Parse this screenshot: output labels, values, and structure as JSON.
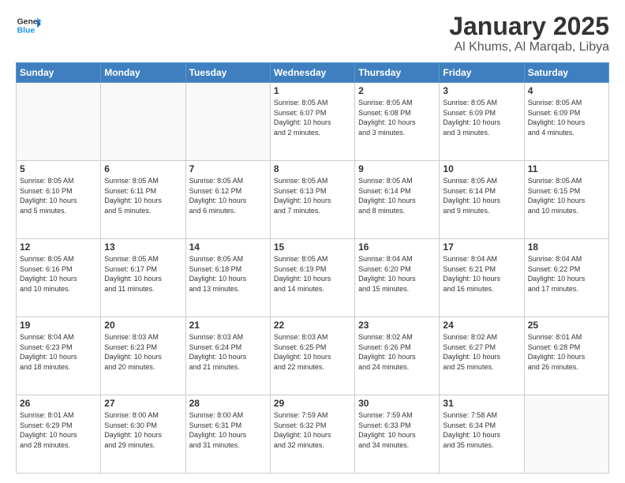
{
  "header": {
    "logo_line1": "General",
    "logo_line2": "Blue",
    "month": "January 2025",
    "location": "Al Khums, Al Marqab, Libya"
  },
  "days_of_week": [
    "Sunday",
    "Monday",
    "Tuesday",
    "Wednesday",
    "Thursday",
    "Friday",
    "Saturday"
  ],
  "weeks": [
    [
      {
        "day": "",
        "info": ""
      },
      {
        "day": "",
        "info": ""
      },
      {
        "day": "",
        "info": ""
      },
      {
        "day": "1",
        "info": "Sunrise: 8:05 AM\nSunset: 6:07 PM\nDaylight: 10 hours\nand 2 minutes."
      },
      {
        "day": "2",
        "info": "Sunrise: 8:05 AM\nSunset: 6:08 PM\nDaylight: 10 hours\nand 3 minutes."
      },
      {
        "day": "3",
        "info": "Sunrise: 8:05 AM\nSunset: 6:09 PM\nDaylight: 10 hours\nand 3 minutes."
      },
      {
        "day": "4",
        "info": "Sunrise: 8:05 AM\nSunset: 6:09 PM\nDaylight: 10 hours\nand 4 minutes."
      }
    ],
    [
      {
        "day": "5",
        "info": "Sunrise: 8:05 AM\nSunset: 6:10 PM\nDaylight: 10 hours\nand 5 minutes."
      },
      {
        "day": "6",
        "info": "Sunrise: 8:05 AM\nSunset: 6:11 PM\nDaylight: 10 hours\nand 5 minutes."
      },
      {
        "day": "7",
        "info": "Sunrise: 8:05 AM\nSunset: 6:12 PM\nDaylight: 10 hours\nand 6 minutes."
      },
      {
        "day": "8",
        "info": "Sunrise: 8:05 AM\nSunset: 6:13 PM\nDaylight: 10 hours\nand 7 minutes."
      },
      {
        "day": "9",
        "info": "Sunrise: 8:05 AM\nSunset: 6:14 PM\nDaylight: 10 hours\nand 8 minutes."
      },
      {
        "day": "10",
        "info": "Sunrise: 8:05 AM\nSunset: 6:14 PM\nDaylight: 10 hours\nand 9 minutes."
      },
      {
        "day": "11",
        "info": "Sunrise: 8:05 AM\nSunset: 6:15 PM\nDaylight: 10 hours\nand 10 minutes."
      }
    ],
    [
      {
        "day": "12",
        "info": "Sunrise: 8:05 AM\nSunset: 6:16 PM\nDaylight: 10 hours\nand 10 minutes."
      },
      {
        "day": "13",
        "info": "Sunrise: 8:05 AM\nSunset: 6:17 PM\nDaylight: 10 hours\nand 11 minutes."
      },
      {
        "day": "14",
        "info": "Sunrise: 8:05 AM\nSunset: 6:18 PM\nDaylight: 10 hours\nand 13 minutes."
      },
      {
        "day": "15",
        "info": "Sunrise: 8:05 AM\nSunset: 6:19 PM\nDaylight: 10 hours\nand 14 minutes."
      },
      {
        "day": "16",
        "info": "Sunrise: 8:04 AM\nSunset: 6:20 PM\nDaylight: 10 hours\nand 15 minutes."
      },
      {
        "day": "17",
        "info": "Sunrise: 8:04 AM\nSunset: 6:21 PM\nDaylight: 10 hours\nand 16 minutes."
      },
      {
        "day": "18",
        "info": "Sunrise: 8:04 AM\nSunset: 6:22 PM\nDaylight: 10 hours\nand 17 minutes."
      }
    ],
    [
      {
        "day": "19",
        "info": "Sunrise: 8:04 AM\nSunset: 6:23 PM\nDaylight: 10 hours\nand 18 minutes."
      },
      {
        "day": "20",
        "info": "Sunrise: 8:03 AM\nSunset: 6:23 PM\nDaylight: 10 hours\nand 20 minutes."
      },
      {
        "day": "21",
        "info": "Sunrise: 8:03 AM\nSunset: 6:24 PM\nDaylight: 10 hours\nand 21 minutes."
      },
      {
        "day": "22",
        "info": "Sunrise: 8:03 AM\nSunset: 6:25 PM\nDaylight: 10 hours\nand 22 minutes."
      },
      {
        "day": "23",
        "info": "Sunrise: 8:02 AM\nSunset: 6:26 PM\nDaylight: 10 hours\nand 24 minutes."
      },
      {
        "day": "24",
        "info": "Sunrise: 8:02 AM\nSunset: 6:27 PM\nDaylight: 10 hours\nand 25 minutes."
      },
      {
        "day": "25",
        "info": "Sunrise: 8:01 AM\nSunset: 6:28 PM\nDaylight: 10 hours\nand 26 minutes."
      }
    ],
    [
      {
        "day": "26",
        "info": "Sunrise: 8:01 AM\nSunset: 6:29 PM\nDaylight: 10 hours\nand 28 minutes."
      },
      {
        "day": "27",
        "info": "Sunrise: 8:00 AM\nSunset: 6:30 PM\nDaylight: 10 hours\nand 29 minutes."
      },
      {
        "day": "28",
        "info": "Sunrise: 8:00 AM\nSunset: 6:31 PM\nDaylight: 10 hours\nand 31 minutes."
      },
      {
        "day": "29",
        "info": "Sunrise: 7:59 AM\nSunset: 6:32 PM\nDaylight: 10 hours\nand 32 minutes."
      },
      {
        "day": "30",
        "info": "Sunrise: 7:59 AM\nSunset: 6:33 PM\nDaylight: 10 hours\nand 34 minutes."
      },
      {
        "day": "31",
        "info": "Sunrise: 7:58 AM\nSunset: 6:34 PM\nDaylight: 10 hours\nand 35 minutes."
      },
      {
        "day": "",
        "info": ""
      }
    ]
  ]
}
